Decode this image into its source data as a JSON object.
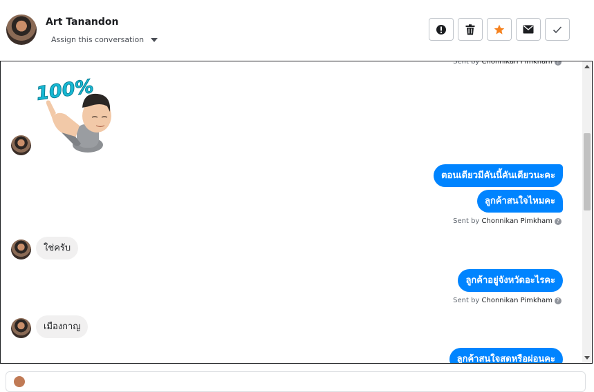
{
  "header": {
    "name": "Art Tanandon",
    "assign_label": "Assign this conversation",
    "actions": [
      {
        "id": "spam",
        "icon": "alert-circle-icon"
      },
      {
        "id": "delete",
        "icon": "trash-icon"
      },
      {
        "id": "star",
        "icon": "star-icon",
        "color": "#f5821f"
      },
      {
        "id": "unread",
        "icon": "envelope-icon"
      },
      {
        "id": "done",
        "icon": "check-icon"
      }
    ]
  },
  "thread": {
    "sent_by_prefix": "Sent by",
    "sender": "Chonnikan Pimkham",
    "sticker_text": "100%",
    "outgoing_color": "#0084ff",
    "messages": [
      {
        "dir": "out",
        "text": "ตอนเดียวมีคันนี้คันเดียวนะคะ"
      },
      {
        "dir": "out",
        "text": "ลูกค้าสนใจไหมคะ"
      },
      {
        "dir": "in",
        "text": "ใช่ครับ"
      },
      {
        "dir": "out",
        "text": "ลูกค้าอยู่จังหวัดอะไรคะ"
      },
      {
        "dir": "in",
        "text": "เมืองกาญ"
      },
      {
        "dir": "out",
        "text": "ลูกค้าสนใจสดหรือผ่อนคะ"
      }
    ]
  }
}
